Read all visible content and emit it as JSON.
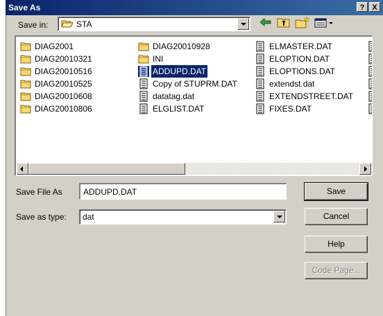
{
  "dialog": {
    "title": "Save As",
    "help_button": "?",
    "close_button": "X"
  },
  "save_in": {
    "label": "Save in:",
    "value": "STA"
  },
  "files": [
    {
      "name": "DIAG2001",
      "type": "folder"
    },
    {
      "name": "DIAG20010321",
      "type": "folder"
    },
    {
      "name": "DIAG20010516",
      "type": "folder"
    },
    {
      "name": "DIAG20010525",
      "type": "folder"
    },
    {
      "name": "DIAG20010608",
      "type": "folder"
    },
    {
      "name": "DIAG20010806",
      "type": "folder"
    },
    {
      "name": "DIAG20010928",
      "type": "folder"
    },
    {
      "name": "INI",
      "type": "folder"
    },
    {
      "name": "ADDUPD.DAT",
      "type": "file",
      "selected": true
    },
    {
      "name": "Copy of STUPRM.DAT",
      "type": "file"
    },
    {
      "name": "datatag.dat",
      "type": "file"
    },
    {
      "name": "ELGLIST.DAT",
      "type": "file"
    },
    {
      "name": "ELMASTER.DAT",
      "type": "file"
    },
    {
      "name": "ELOPTION.DAT",
      "type": "file"
    },
    {
      "name": "ELOPTIONS.DAT",
      "type": "file"
    },
    {
      "name": "extendst.dat",
      "type": "file"
    },
    {
      "name": "EXTENDSTREET.DAT",
      "type": "file"
    },
    {
      "name": "FIXES.DAT",
      "type": "file"
    }
  ],
  "save_file_as": {
    "label": "Save File As",
    "value": "ADDUPD.DAT"
  },
  "save_as_type": {
    "label": "Save as type:",
    "value": "dat"
  },
  "buttons": {
    "save": "Save",
    "cancel": "Cancel",
    "help": "Help",
    "code_page": "Code Page..."
  },
  "colors": {
    "titlebar_start": "#0a246a",
    "titlebar_end": "#3a6ea5",
    "selection": "#0a246a",
    "face": "#d4d0c8",
    "folder": "#f8d775"
  }
}
